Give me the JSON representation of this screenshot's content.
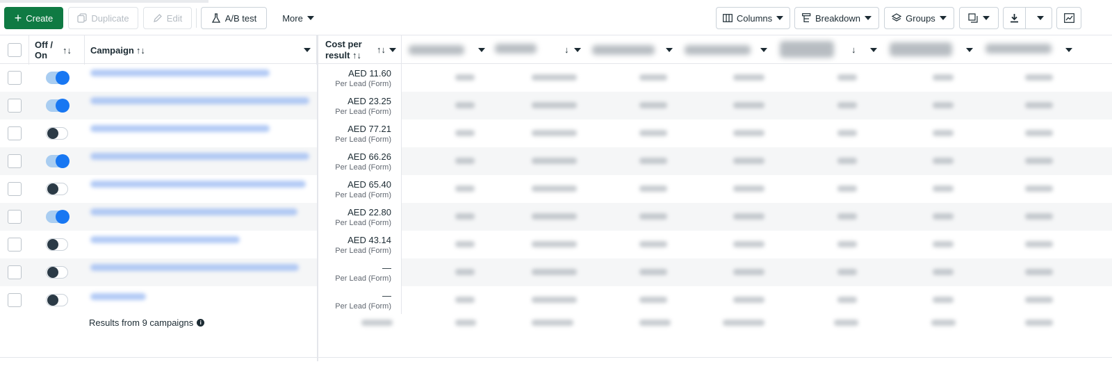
{
  "toolbar": {
    "create_label": "Create",
    "duplicate_label": "Duplicate",
    "edit_label": "Edit",
    "abtest_label": "A/B test",
    "more_label": "More",
    "columns_label": "Columns",
    "breakdown_label": "Breakdown",
    "groups_label": "Groups"
  },
  "table": {
    "headers": {
      "off_on": "Off /",
      "off_on_2": "On",
      "campaign": "Campaign",
      "cost_per_result_1": "Cost per",
      "cost_per_result_2": "result",
      "sort_glyph": "↑↓"
    },
    "rows": [
      {
        "on": true,
        "cost": "AED 11.60",
        "unit": "Per Lead (Form)"
      },
      {
        "on": true,
        "cost": "AED 23.25",
        "unit": "Per Lead (Form)"
      },
      {
        "on": false,
        "cost": "AED 77.21",
        "unit": "Per Lead (Form)"
      },
      {
        "on": true,
        "cost": "AED 66.26",
        "unit": "Per Lead (Form)"
      },
      {
        "on": false,
        "cost": "AED 65.40",
        "unit": "Per Lead (Form)"
      },
      {
        "on": true,
        "cost": "AED 22.80",
        "unit": "Per Lead (Form)"
      },
      {
        "on": false,
        "cost": "AED 43.14",
        "unit": "Per Lead (Form)"
      },
      {
        "on": false,
        "cost": "—",
        "unit": "Per Lead (Form)"
      },
      {
        "on": false,
        "cost": "—",
        "unit": "Per Lead (Form)"
      }
    ],
    "footer": "Results from 9 campaigns"
  },
  "colors": {
    "primary": "#0f7a43",
    "toggle_on": "#1877f2",
    "link_blur": "#9fbdf3"
  }
}
